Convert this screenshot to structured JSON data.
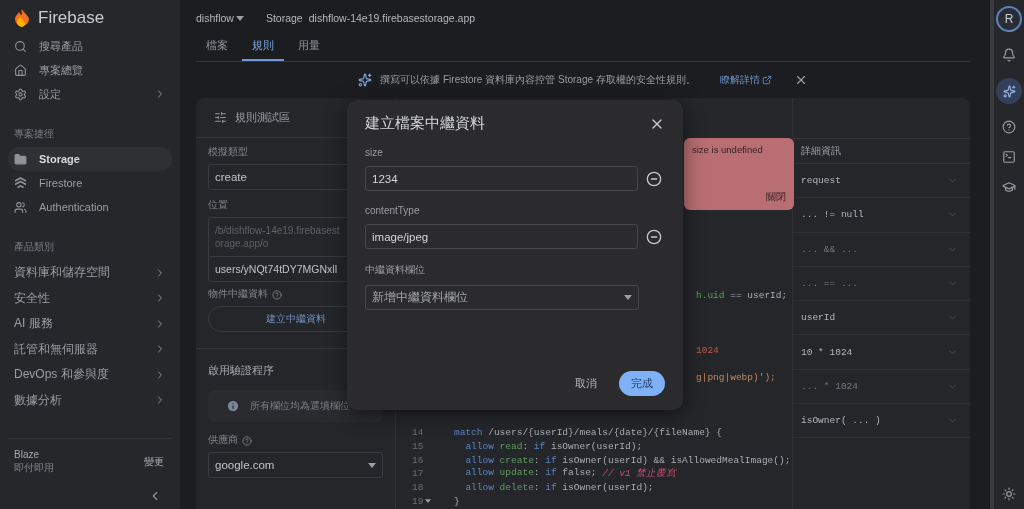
{
  "sidebar": {
    "brand": "Firebase",
    "top_items": [
      {
        "label": "搜尋產品",
        "chevron": false
      },
      {
        "label": "專案總覽",
        "chevron": false
      },
      {
        "label": "設定",
        "chevron": true
      }
    ],
    "shortcuts_title": "專案捷徑",
    "shortcuts": [
      {
        "label": "Storage",
        "selected": true
      },
      {
        "label": "Firestore",
        "selected": false
      },
      {
        "label": "Authentication",
        "selected": false
      }
    ],
    "categories_title": "產品類別",
    "categories": [
      {
        "label": "資料庫和儲存空間"
      },
      {
        "label": "安全性"
      },
      {
        "label": "AI 服務"
      },
      {
        "label": "託管和無伺服器"
      },
      {
        "label": "DevOps 和參與度"
      },
      {
        "label": "數據分析"
      }
    ],
    "plan": {
      "name": "Blaze",
      "subtitle": "即付即用",
      "action": "變更"
    }
  },
  "header": {
    "project": "dishflow",
    "product": "Storage",
    "bucket": "dishflow-14e19.firebasestorage.app"
  },
  "tabs": [
    {
      "label": "檔案",
      "selected": false
    },
    {
      "label": "規則",
      "selected": true
    },
    {
      "label": "用量",
      "selected": false
    }
  ],
  "banner": {
    "text": "撰寫可以依據 Firestore 資料庫內容控管 Storage 存取權的安全性規則。",
    "link": "瞭解詳情"
  },
  "playground": {
    "title": "規則測試區",
    "simulation_type": {
      "label": "模擬類型",
      "value": "create"
    },
    "location": {
      "label": "位置",
      "prefix": "/b/dishflow-14e19.firebasestorage.app/o",
      "value": "users/yNQt74tDY7MGNxlI"
    },
    "metadata": {
      "label": "物件中繼資料",
      "button": "建立中繼資料"
    },
    "auth": {
      "title": "啟用驗證程序",
      "info": "所有欄位均為選填欄位",
      "provider_label": "供應商",
      "provider": "google.com"
    }
  },
  "error_card": {
    "message": "size is undefined",
    "close": "關閉"
  },
  "code": {
    "lines": [
      {
        "kind": "covered",
        "segments": [
          {
            "text": "h.uid",
            "kind": "prop"
          },
          {
            "text": " == userId;",
            "kind": "plain"
          }
        ]
      },
      {
        "kind": "covered"
      },
      {
        "kind": "covered"
      },
      {
        "kind": "covered"
      },
      {
        "kind": "covered",
        "segments": [
          {
            "text": "1024",
            "kind": "num"
          }
        ]
      },
      {
        "kind": "covered"
      },
      {
        "kind": "covered",
        "segments": [
          {
            "text": "g|png|webp)');",
            "kind": "str"
          }
        ]
      },
      {
        "kind": "covered"
      },
      {
        "kind": "covered"
      },
      {
        "kind": "covered"
      },
      {
        "number": "14",
        "segments": [
          {
            "text": "match",
            "kind": "kw"
          },
          {
            "text": " /users/{userId}/meals/{date}/{fileName} {",
            "kind": "plain"
          }
        ]
      },
      {
        "number": "15",
        "segments": [
          {
            "text": "  allow",
            "kind": "kw"
          },
          {
            "text": " read",
            "kind": "prop"
          },
          {
            "text": ": ",
            "kind": "plain"
          },
          {
            "text": "if",
            "kind": "kw"
          },
          {
            "text": " isOwner(userId);",
            "kind": "plain"
          }
        ]
      },
      {
        "number": "16",
        "segments": [
          {
            "text": "  allow",
            "kind": "kw"
          },
          {
            "text": " create",
            "kind": "prop"
          },
          {
            "text": ": ",
            "kind": "plain"
          },
          {
            "text": "if",
            "kind": "kw"
          },
          {
            "text": " isOwner(userId) && isAllowedMealImage();",
            "kind": "plain"
          }
        ]
      },
      {
        "number": "17",
        "segments": [
          {
            "text": "  allow",
            "kind": "kw"
          },
          {
            "text": " update",
            "kind": "prop"
          },
          {
            "text": ": ",
            "kind": "plain"
          },
          {
            "text": "if",
            "kind": "kw"
          },
          {
            "text": " false; ",
            "kind": "plain"
          },
          {
            "text": "// v1 禁止覆寫",
            "kind": "comment"
          }
        ]
      },
      {
        "number": "18",
        "segments": [
          {
            "text": "  allow",
            "kind": "kw"
          },
          {
            "text": " delete",
            "kind": "prop"
          },
          {
            "text": ": ",
            "kind": "plain"
          },
          {
            "text": "if",
            "kind": "kw"
          },
          {
            "text": " isOwner(userId);",
            "kind": "plain"
          }
        ]
      },
      {
        "number": "19",
        "fold": true,
        "segments": [
          {
            "text": "}",
            "kind": "plain"
          }
        ]
      }
    ]
  },
  "details": {
    "title": "詳細資訊",
    "rows": [
      {
        "label": "request",
        "dimmed": false
      },
      {
        "label": "... != null",
        "dimmed": false
      },
      {
        "label": "... && ...",
        "dimmed": true
      },
      {
        "label": "... == ...",
        "dimmed": true
      },
      {
        "label": "userId",
        "dimmed": false
      },
      {
        "label": "10 * 1024",
        "dimmed": false
      },
      {
        "label": "... * 1024",
        "dimmed": true
      },
      {
        "label": "isOwner( ... )",
        "dimmed": false
      }
    ]
  },
  "rail": {
    "avatar": "R"
  },
  "dialog": {
    "title": "建立檔案中繼資料",
    "fields": [
      {
        "label": "size",
        "value": "1234"
      },
      {
        "label": "contentType",
        "value": "image/jpeg"
      }
    ],
    "select": {
      "label": "中繼資料欄位",
      "placeholder": "新增中繼資料欄位"
    },
    "buttons": [
      {
        "label": "取消",
        "kind": "text"
      },
      {
        "label": "完成",
        "kind": "primary"
      }
    ]
  }
}
